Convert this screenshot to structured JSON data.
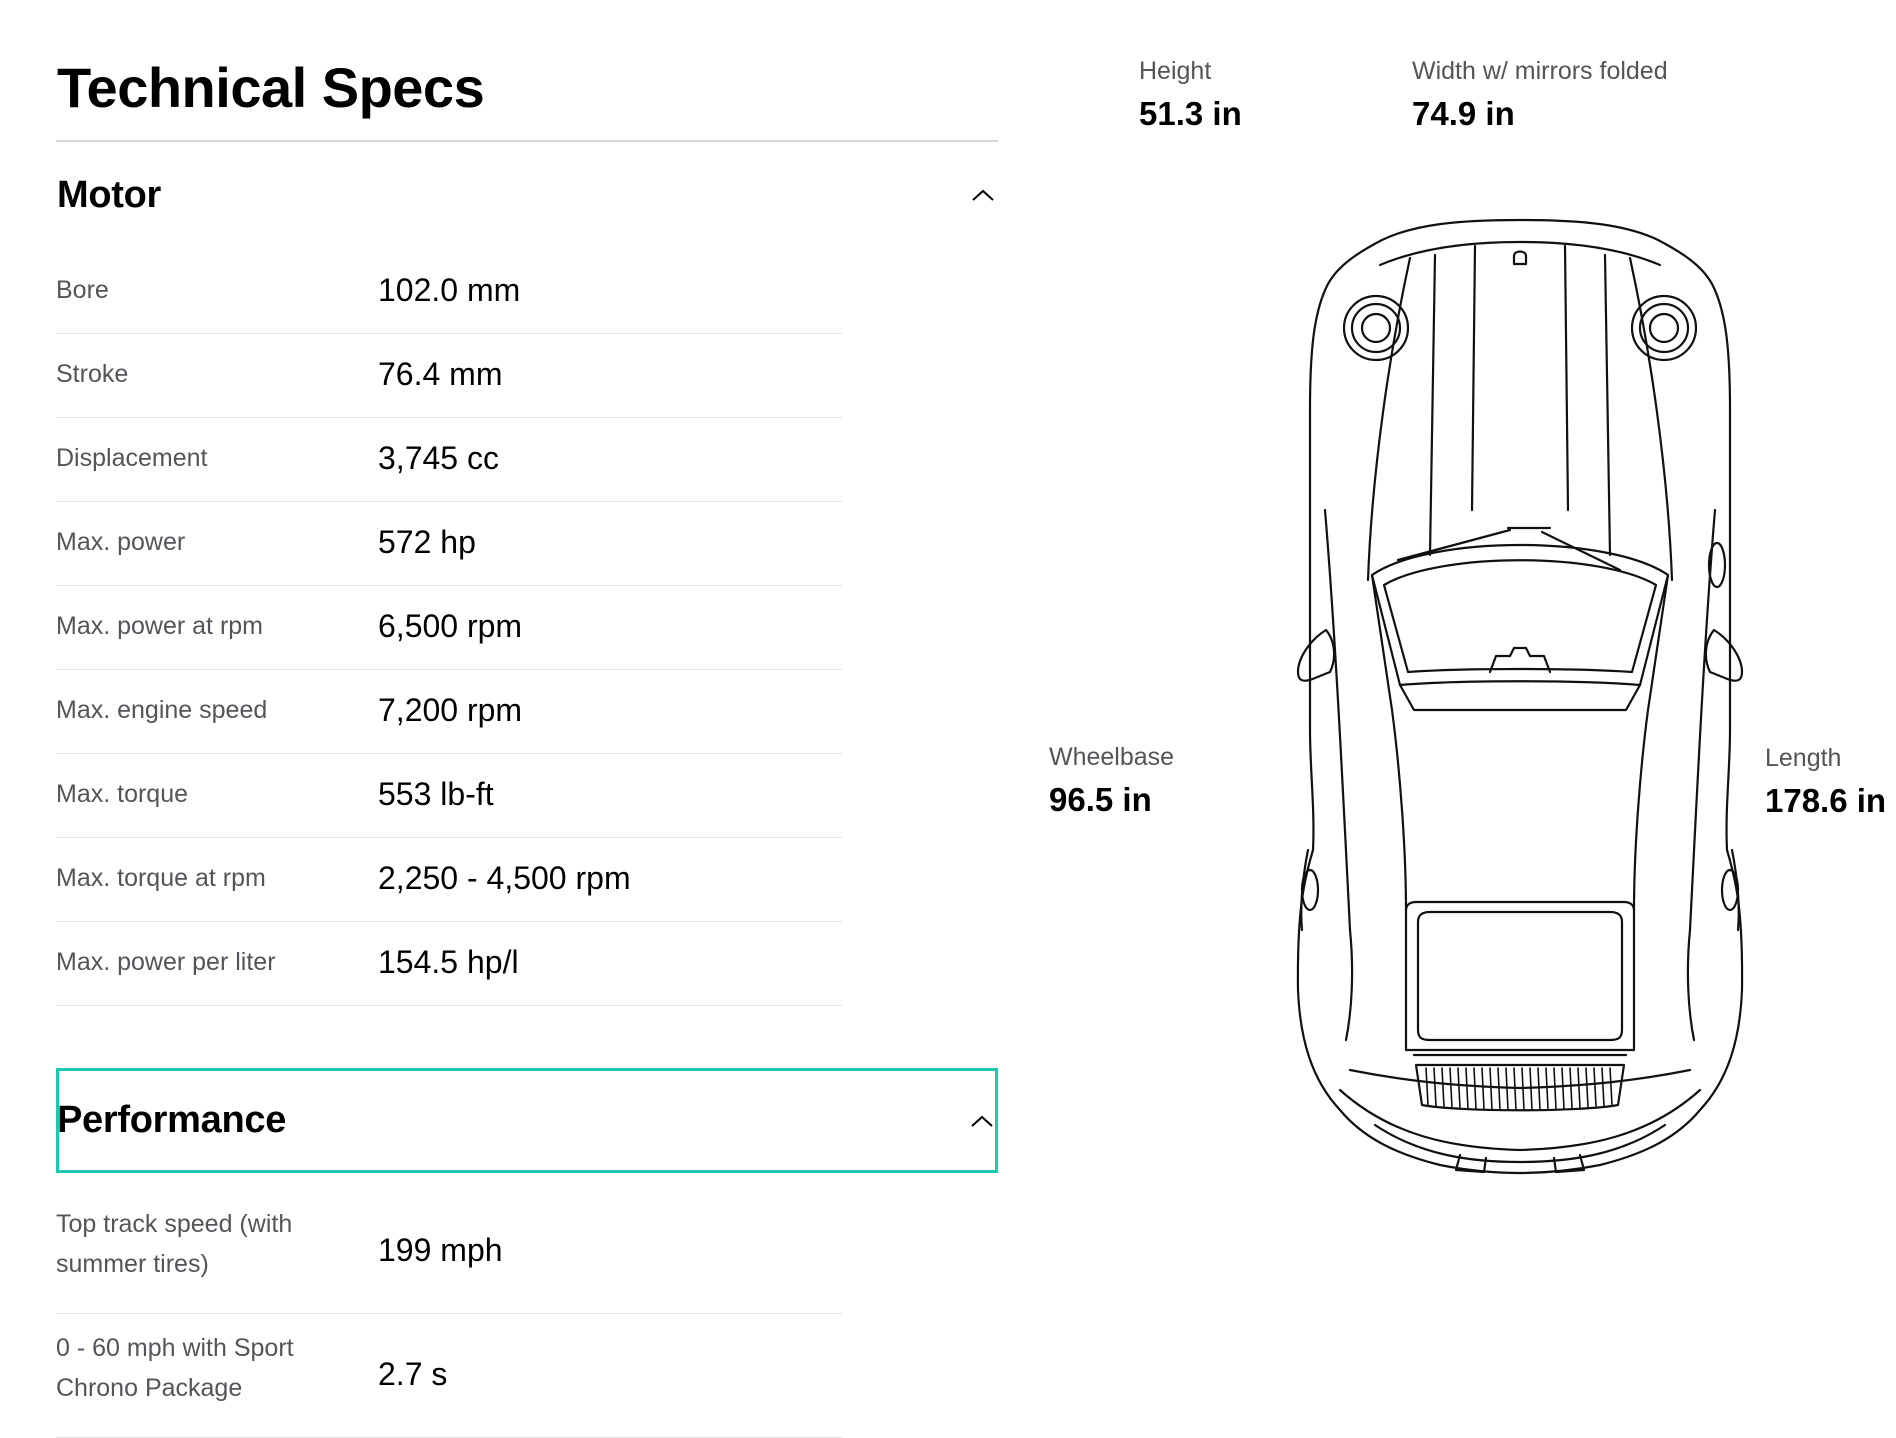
{
  "page": {
    "title": "Technical Specs"
  },
  "sections": {
    "motor": {
      "title": "Motor",
      "rows": [
        {
          "label": "Bore",
          "value": "102.0 mm"
        },
        {
          "label": "Stroke",
          "value": "76.4 mm"
        },
        {
          "label": "Displacement",
          "value": "3,745 cc"
        },
        {
          "label": "Max. power",
          "value": "572 hp"
        },
        {
          "label": "Max. power at rpm",
          "value": "6,500 rpm"
        },
        {
          "label": "Max. engine speed",
          "value": "7,200 rpm"
        },
        {
          "label": "Max. torque",
          "value": "553 lb-ft"
        },
        {
          "label": "Max. torque at rpm",
          "value": "2,250 - 4,500 rpm"
        },
        {
          "label": "Max. power per liter",
          "value": "154.5 hp/l"
        }
      ]
    },
    "performance": {
      "title": "Performance",
      "rows": [
        {
          "label": "Top track speed (with summer tires)",
          "value": "199 mph"
        },
        {
          "label": "0 - 60 mph with Sport Chrono Package",
          "value": "2.7 s"
        }
      ]
    }
  },
  "dimensions": {
    "height": {
      "label": "Height",
      "value": "51.3 in"
    },
    "width": {
      "label": "Width w/ mirrors folded",
      "value": "74.9 in"
    },
    "wheelbase": {
      "label": "Wheelbase",
      "value": "96.5 in"
    },
    "length": {
      "label": "Length",
      "value": "178.6 in"
    }
  },
  "icons": {
    "section_toggle": "chevron-up-icon",
    "car": "car-top-view-icon"
  },
  "colors": {
    "focus_outline": "#1fc7b0",
    "label_text": "#525559",
    "divider": "#e1e3e5"
  }
}
